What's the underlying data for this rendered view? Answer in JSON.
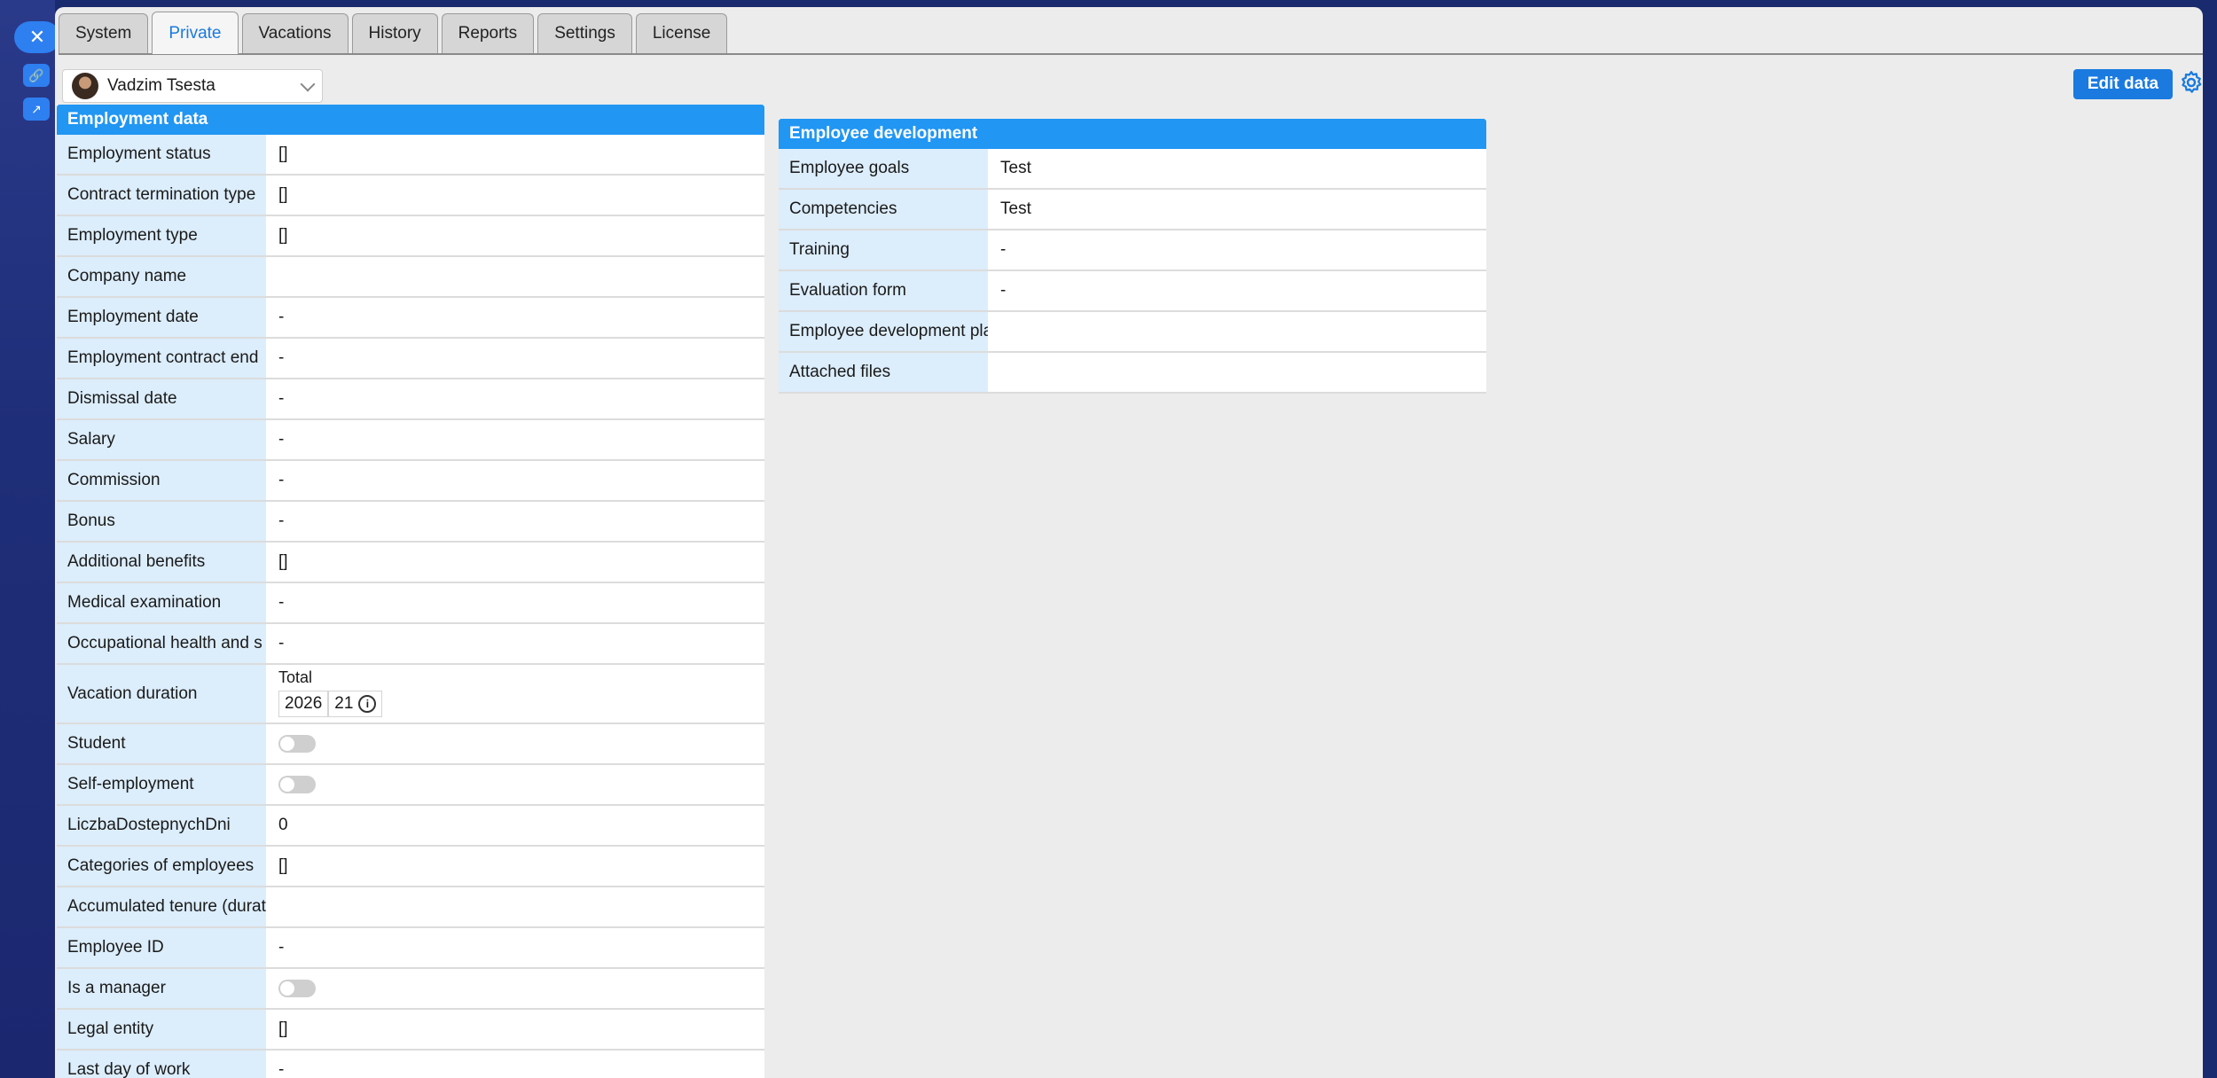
{
  "tabs": [
    "System",
    "Private",
    "Vacations",
    "History",
    "Reports",
    "Settings",
    "License"
  ],
  "active_tab": "Private",
  "user": {
    "name": "Vadzim Tsesta"
  },
  "edit_button": "Edit data",
  "employment": {
    "title": "Employment data",
    "rows": [
      {
        "label": "Employment status",
        "value": "[]"
      },
      {
        "label": "Contract termination type",
        "value": "[]"
      },
      {
        "label": "Employment type",
        "value": "[]"
      },
      {
        "label": "Company name",
        "value": ""
      },
      {
        "label": "Employment date",
        "value": "-"
      },
      {
        "label": "Employment contract end",
        "value": "-"
      },
      {
        "label": "Dismissal date",
        "value": "-"
      },
      {
        "label": "Salary",
        "value": "-"
      },
      {
        "label": "Commission",
        "value": "-"
      },
      {
        "label": "Bonus",
        "value": "-"
      },
      {
        "label": "Additional benefits",
        "value": "[]"
      },
      {
        "label": "Medical examination",
        "value": "-"
      },
      {
        "label": "Occupational health and s",
        "value": "-"
      }
    ],
    "vacation": {
      "label": "Vacation duration",
      "total_label": "Total",
      "year": "2026",
      "days": "21"
    },
    "rows2": [
      {
        "label": "Student",
        "toggle": false
      },
      {
        "label": "Self-employment",
        "toggle": false
      },
      {
        "label": "LiczbaDostepnychDni",
        "value": "0"
      },
      {
        "label": "Categories of employees",
        "value": "[]"
      },
      {
        "label": "Accumulated tenure (durat",
        "value": ""
      },
      {
        "label": "Employee ID",
        "value": "-"
      },
      {
        "label": "Is a manager",
        "toggle": false
      },
      {
        "label": "Legal entity",
        "value": "[]"
      },
      {
        "label": "Last day of work",
        "value": "-"
      }
    ]
  },
  "development": {
    "title": "Employee development",
    "rows": [
      {
        "label": "Employee goals",
        "value": "Test"
      },
      {
        "label": "Competencies",
        "value": "Test"
      },
      {
        "label": "Training",
        "value": "-"
      },
      {
        "label": "Evaluation form",
        "value": "-"
      },
      {
        "label": "Employee development pla",
        "value": ""
      },
      {
        "label": "Attached files",
        "value": ""
      }
    ]
  }
}
